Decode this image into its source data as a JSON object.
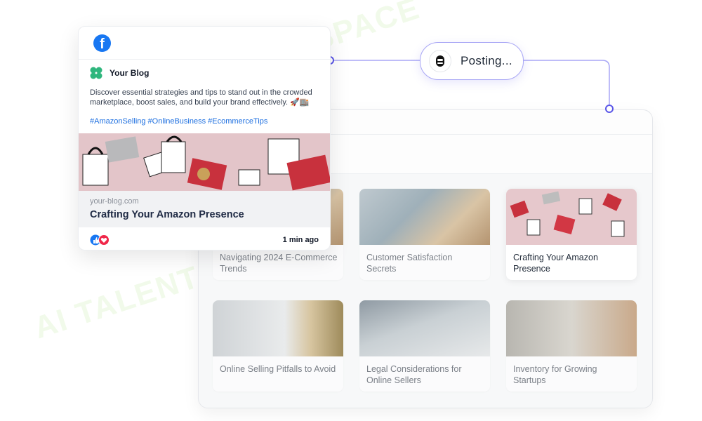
{
  "watermark": {
    "text": "AI TALENT SPACE"
  },
  "posting": {
    "label": "Posting..."
  },
  "facebook_post": {
    "blog_name": "Your Blog",
    "text": "Discover essential strategies and tips to stand out in the crowded marketplace, boost sales, and build your brand effectively. 🚀🏬",
    "hashtags": "#AmazonSelling #OnlineBusiness #EcommerceTips",
    "link_domain": "your-blog.com",
    "link_title": "Crafting Your Amazon Presence",
    "time": "1 min ago"
  },
  "blog_grid": {
    "cards": [
      {
        "title": "Navigating 2024 E-Commerce Trends"
      },
      {
        "title": "Customer Satisfaction Secrets"
      },
      {
        "title": "Crafting Your Amazon Presence"
      },
      {
        "title": "Online Selling Pitfalls to Avoid"
      },
      {
        "title": "Legal Considerations for Online Sellers"
      },
      {
        "title": "Inventory for Growing Startups"
      }
    ]
  },
  "colors": {
    "accent": "#a8a6f5",
    "facebook": "#1877f2",
    "hashtag": "#1d6fe0"
  }
}
